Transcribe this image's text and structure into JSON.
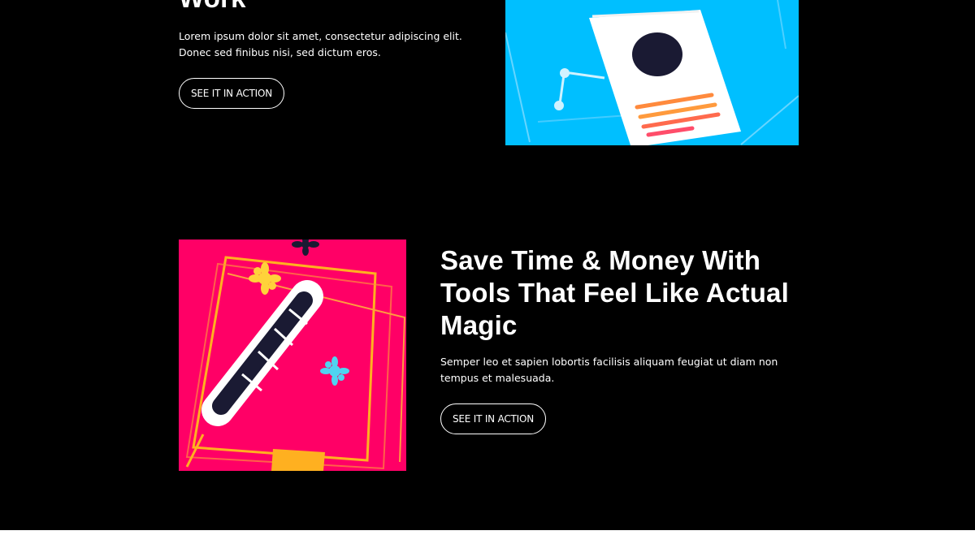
{
  "section_1": {
    "heading": "Work",
    "body": "Lorem ipsum dolor sit amet, consectetur adipiscing elit. Donec sed finibus nisi, sed dictum eros.",
    "button_label": "SEE IT IN ACTION",
    "illustration": {
      "icon": "document-with-pushpin-icon",
      "background": "#00BFFF"
    }
  },
  "section_2": {
    "heading": "Save Time & Money With Tools That Feel Like Actual Magic",
    "body": "Semper leo et sapien lobortis facilisis aliquam feugiat ut diam non tempus et malesuada.",
    "button_label": "SEE IT IN ACTION",
    "illustration": {
      "icon": "magic-wand-book-icon",
      "background": "#FF0066"
    }
  },
  "colors": {
    "page_background": "#000000",
    "text": "#FFFFFF",
    "footer_band": "#FFFFFF"
  }
}
